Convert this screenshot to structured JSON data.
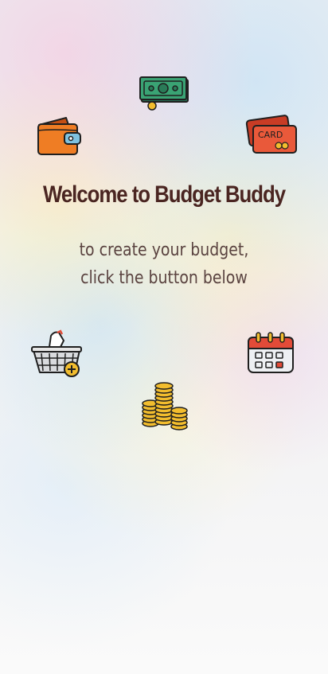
{
  "header": {
    "title": "Welcome to Budget Buddy"
  },
  "instructions": {
    "line1": "to create your budget,",
    "line2": "click the button below"
  },
  "icons": {
    "cash": "cash-icon",
    "wallet": "wallet-icon",
    "card": "credit-card-icon",
    "card_text": "CARD",
    "basket": "shopping-basket-icon",
    "calendar": "calendar-icon",
    "coins": "coins-icon"
  },
  "colors": {
    "title": "#4a2521",
    "subtitle": "#5a4340",
    "cash_green": "#3a9f73",
    "wallet_orange": "#ef7d24",
    "card_red": "#e9593a",
    "coin_gold": "#f2bd2e",
    "calendar_red": "#e34b38"
  }
}
